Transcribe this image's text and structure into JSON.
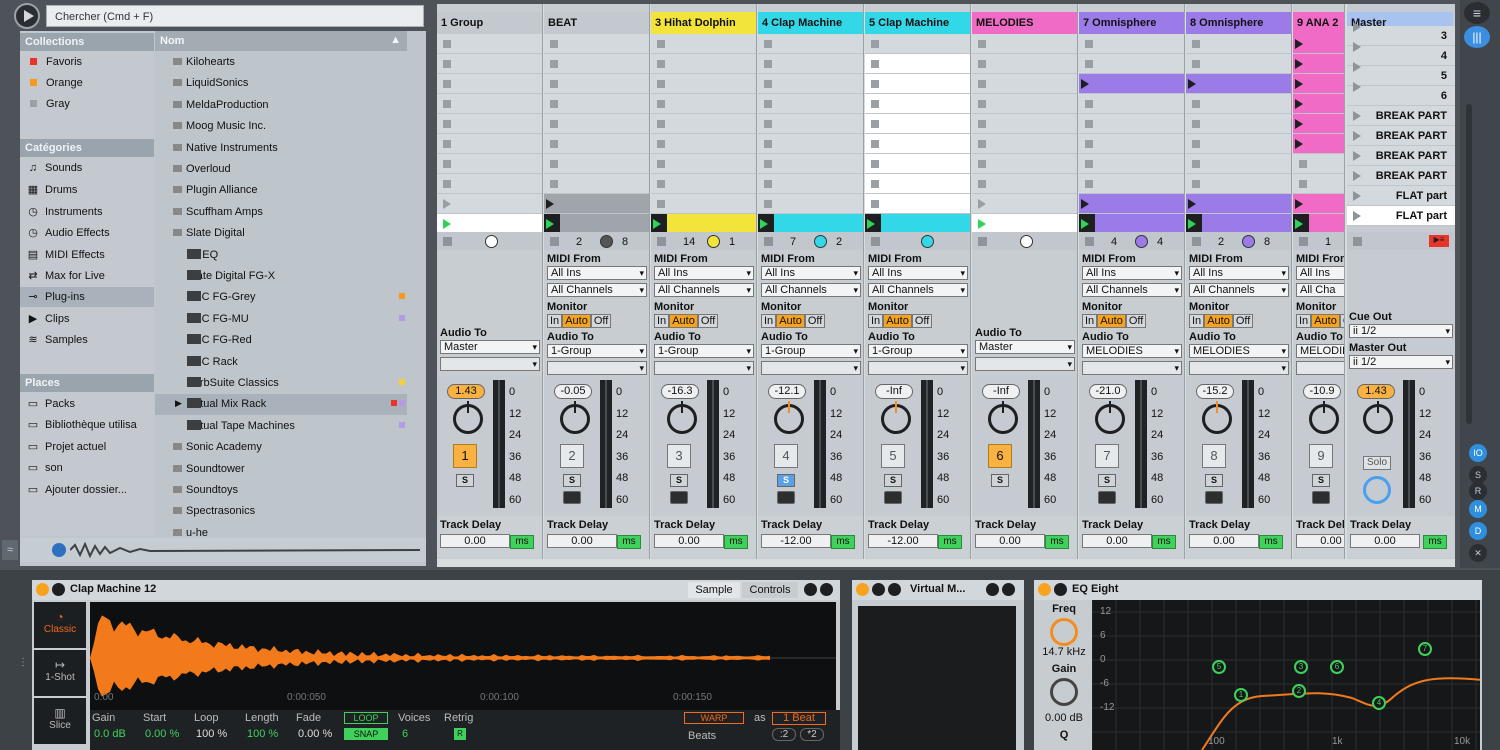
{
  "search": {
    "placeholder": "Chercher (Cmd + F)"
  },
  "collections": {
    "header": "Collections",
    "items": [
      {
        "label": "Favoris",
        "color": "#e8342b"
      },
      {
        "label": "Orange",
        "color": "#f59a1d"
      },
      {
        "label": "Gray",
        "color": "#9aa0a5"
      }
    ]
  },
  "categories": {
    "header": "Catégories",
    "items": [
      {
        "label": "Sounds",
        "icon": "note-icon"
      },
      {
        "label": "Drums",
        "icon": "grid-icon"
      },
      {
        "label": "Instruments",
        "icon": "clock-icon"
      },
      {
        "label": "Audio Effects",
        "icon": "clock-icon"
      },
      {
        "label": "MIDI Effects",
        "icon": "midi-icon"
      },
      {
        "label": "Max for Live",
        "icon": "max-icon"
      },
      {
        "label": "Plug-ins",
        "icon": "plug-icon"
      },
      {
        "label": "Clips",
        "icon": "clip-icon"
      },
      {
        "label": "Samples",
        "icon": "wave-icon"
      }
    ]
  },
  "places": {
    "header": "Places",
    "items": [
      {
        "label": "Packs"
      },
      {
        "label": "Bibliothèque utilisa"
      },
      {
        "label": "Projet actuel"
      },
      {
        "label": "son"
      },
      {
        "label": "Ajouter dossier..."
      }
    ]
  },
  "list": {
    "header": "Nom",
    "items": [
      {
        "label": "Kilohearts",
        "child": false
      },
      {
        "label": "LiquidSonics",
        "child": false
      },
      {
        "label": "MeldaProduction",
        "child": false
      },
      {
        "label": "Moog Music Inc.",
        "child": false
      },
      {
        "label": "Native Instruments",
        "child": false
      },
      {
        "label": "Overloud",
        "child": false
      },
      {
        "label": "Plugin Alliance",
        "child": false
      },
      {
        "label": "Scuffham Amps",
        "child": false
      },
      {
        "label": "Slate Digital",
        "child": false
      },
      {
        "label": "Inf EQ",
        "child": true
      },
      {
        "label": "Slate Digital FG-X",
        "child": true
      },
      {
        "label": "VBC FG-Grey",
        "child": true,
        "dot": "#f59a1d"
      },
      {
        "label": "VBC FG-MU",
        "child": true,
        "dot": "#b59ae8"
      },
      {
        "label": "VBC FG-Red",
        "child": true
      },
      {
        "label": "VBC Rack",
        "child": true
      },
      {
        "label": "VerbSuite Classics",
        "child": true,
        "dot": "#f2d23b"
      },
      {
        "label": "Virtual Mix Rack",
        "child": true,
        "dot": "#e8342b",
        "dot2": "#b59ae8"
      },
      {
        "label": "Virtual Tape Machines",
        "child": true,
        "dot": "#b59ae8"
      },
      {
        "label": "Sonic Academy",
        "child": false
      },
      {
        "label": "Soundtower",
        "child": false
      },
      {
        "label": "Soundtoys",
        "child": false
      },
      {
        "label": "Spectrasonics",
        "child": false
      },
      {
        "label": "u-he",
        "child": false
      }
    ]
  },
  "tracks": [
    {
      "name": "1 Group",
      "color": "#c3c9ce",
      "clip_color": "#ffffff",
      "type": "group",
      "counts": [
        "",
        ""
      ],
      "audio_to": "Master",
      "vol": "1.43",
      "vol_active": true,
      "num": "1",
      "num_active": true,
      "solo_blue": false,
      "delay": "0.00"
    },
    {
      "name": "BEAT",
      "color": "#c3c9ce",
      "clip_color": "#9fa5aa",
      "type": "midi",
      "counts": [
        "2",
        "8"
      ],
      "midi_from": "All Ins",
      "channel": "All Channels",
      "audio_to": "1-Group",
      "vol": "-0.05",
      "vol_active": false,
      "num": "2",
      "num_active": false,
      "solo_blue": false,
      "delay": "0.00"
    },
    {
      "name": "3 Hihat Dolphin",
      "color": "#f2e43a",
      "clip_color": "#f2e43a",
      "type": "midi",
      "counts": [
        "14",
        "1"
      ],
      "midi_from": "All Ins",
      "channel": "All Channels",
      "audio_to": "1-Group",
      "vol": "-16.3",
      "vol_active": false,
      "num": "3",
      "num_active": false,
      "solo_blue": false,
      "delay": "0.00"
    },
    {
      "name": "4 Clap Machine",
      "color": "#33d8e8",
      "clip_color": "#33d8e8",
      "type": "midi",
      "counts": [
        "7",
        "2"
      ],
      "midi_from": "All Ins",
      "channel": "All Channels",
      "audio_to": "1-Group",
      "vol": "-12.1",
      "vol_active": false,
      "num": "4",
      "num_active": false,
      "solo_blue": true,
      "delay": "-12.00"
    },
    {
      "name": "5 Clap Machine",
      "color": "#33d8e8",
      "clip_color": "#33d8e8",
      "type": "midi",
      "counts": [
        "",
        ""
      ],
      "midi_from": "All Ins",
      "channel": "All Channels",
      "audio_to": "1-Group",
      "vol": "-Inf",
      "vol_active": false,
      "num": "5",
      "num_active": false,
      "solo_blue": false,
      "delay": "-12.00"
    },
    {
      "name": "MELODIES",
      "color": "#f06bc6",
      "clip_color": "#ffffff",
      "type": "group",
      "counts": [
        "",
        ""
      ],
      "audio_to": "Master",
      "vol": "-Inf",
      "vol_active": false,
      "num": "6",
      "num_active": true,
      "solo_blue": false,
      "delay": "0.00"
    },
    {
      "name": "7 Omnisphere",
      "color": "#9a7be8",
      "clip_color": "#9a7be8",
      "type": "midi",
      "counts": [
        "4",
        "4"
      ],
      "midi_from": "All Ins",
      "channel": "All Channels",
      "audio_to": "MELODIES",
      "vol": "-21.0",
      "vol_active": false,
      "num": "7",
      "num_active": false,
      "solo_blue": false,
      "delay": "0.00"
    },
    {
      "name": "8 Omnisphere",
      "color": "#9a7be8",
      "clip_color": "#9a7be8",
      "type": "midi",
      "counts": [
        "2",
        "8"
      ],
      "midi_from": "All Ins",
      "channel": "All Channels",
      "audio_to": "MELODIES",
      "vol": "-15.2",
      "vol_active": false,
      "num": "8",
      "num_active": false,
      "solo_blue": false,
      "delay": "0.00"
    },
    {
      "name": "9 ANA 2",
      "color": "#f06bc6",
      "clip_color": "#f06bc6",
      "type": "midi",
      "counts": [
        "1",
        ""
      ],
      "midi_from": "All Ins",
      "channel": "All Cha",
      "audio_to": "MELODIE",
      "vol": "-10.9",
      "vol_active": false,
      "num": "9",
      "num_active": false,
      "solo_blue": false,
      "delay": "0.00"
    }
  ],
  "labels": {
    "midi_from": "MIDI From",
    "monitor": "Monitor",
    "mon_in": "In",
    "mon_auto": "Auto",
    "mon_off": "Off",
    "audio_to": "Audio To",
    "track_delay": "Track Delay",
    "ms": "ms",
    "solo": "S"
  },
  "scale": [
    "0",
    "12",
    "24",
    "36",
    "48",
    "60"
  ],
  "master": {
    "name": "Master",
    "scenes": [
      "3",
      "4",
      "5",
      "6",
      "BREAK PART",
      "BREAK PART",
      "BREAK PART",
      "BREAK PART",
      "FLAT part",
      "FLAT part"
    ],
    "cue_out_label": "Cue Out",
    "cue_out": "ii 1/2",
    "master_out_label": "Master Out",
    "master_out": "ii 1/2",
    "vol": "1.43",
    "solo": "Solo",
    "delay_label": "Track Delay",
    "delay": "0.00",
    "ms": "ms"
  },
  "device1": {
    "title": "Clap Machine 12",
    "tab_sample": "Sample",
    "tab_controls": "Controls",
    "modes": [
      "Classic",
      "1-Shot",
      "Slice"
    ],
    "times": [
      "0:00",
      "0:00:050",
      "0:00:100",
      "0:00:150"
    ],
    "params": [
      {
        "label": "Gain",
        "value": "0.0 dB",
        "green": true
      },
      {
        "label": "Start",
        "value": "0.00 %",
        "green": true
      },
      {
        "label": "Loop",
        "value": "100 %",
        "green": false
      },
      {
        "label": "Length",
        "value": "100 %",
        "green": true
      },
      {
        "label": "Fade",
        "value": "0.00 %",
        "green": false
      }
    ],
    "loop": "LOOP",
    "snap": "SNAP",
    "voices_label": "Voices",
    "voices": "6",
    "retrig_label": "Retrig",
    "retrig": "R",
    "warp": "WARP",
    "as": "as",
    "beat": "1 Beat",
    "beats": "Beats",
    "div": ":2",
    "mul": "*2"
  },
  "device2": {
    "title": "Virtual M..."
  },
  "device3": {
    "title": "EQ Eight",
    "freq_label": "Freq",
    "freq": "14.7 kHz",
    "gain_label": "Gain",
    "gain": "0.00 dB",
    "q_label": "Q",
    "db_labels": [
      "12",
      "6",
      "0",
      "-6",
      "-12"
    ],
    "freq_ticks": [
      "100",
      "1k",
      "10k"
    ],
    "nodes": [
      "1",
      "2",
      "3",
      "4",
      "5",
      "6",
      "7"
    ]
  }
}
